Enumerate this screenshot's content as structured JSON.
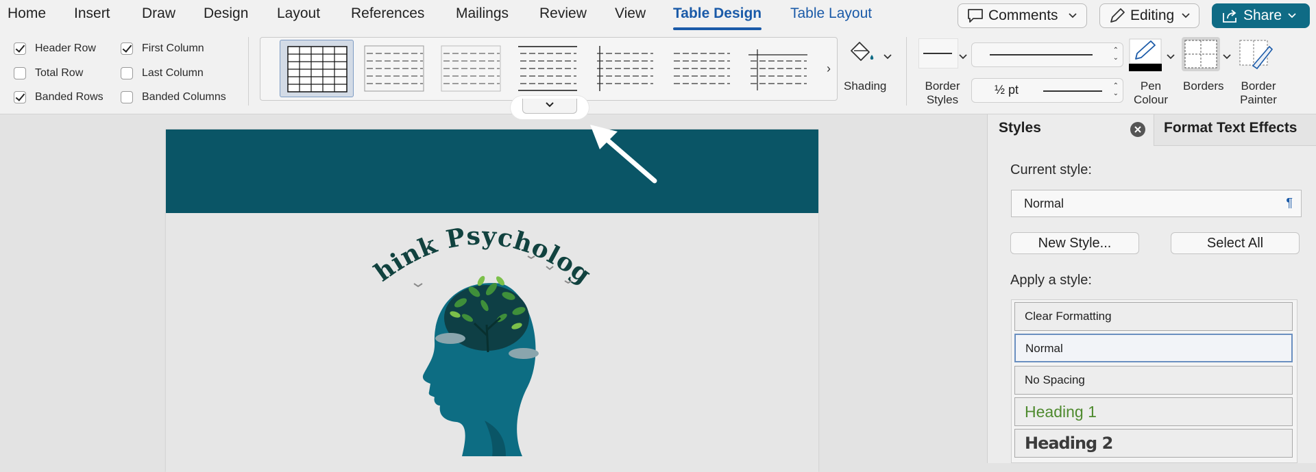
{
  "menu": {
    "tabs": [
      {
        "label": "Home"
      },
      {
        "label": "Insert"
      },
      {
        "label": "Draw"
      },
      {
        "label": "Design"
      },
      {
        "label": "Layout"
      },
      {
        "label": "References"
      },
      {
        "label": "Mailings"
      },
      {
        "label": "Review"
      },
      {
        "label": "View"
      },
      {
        "label": "Table Design",
        "active": true
      },
      {
        "label": "Table Layout"
      }
    ],
    "comments_label": "Comments",
    "editing_label": "Editing",
    "share_label": "Share",
    "share_color": "#0f6b85"
  },
  "ribbon": {
    "options": [
      {
        "label": "Header Row",
        "checked": true
      },
      {
        "label": "Total Row",
        "checked": false
      },
      {
        "label": "Banded Rows",
        "checked": true
      },
      {
        "label": "First Column",
        "checked": true
      },
      {
        "label": "Last Column",
        "checked": false
      },
      {
        "label": "Banded Columns",
        "checked": false
      }
    ],
    "shading_label": "Shading",
    "border_styles_label": "Border Styles",
    "pen_weight": "½ pt",
    "pen_colour_label": "Pen Colour",
    "borders_label": "Borders",
    "border_painter_label": "Border Painter",
    "pen_color": "#000000"
  },
  "document": {
    "band_color": "#0a5566",
    "logo_text": "Think Psychology"
  },
  "styles_pane": {
    "title": "Styles",
    "other_tab": "Format Text Effects",
    "current_style_label": "Current style:",
    "current_style": "Normal",
    "new_style_button": "New Style...",
    "select_all_button": "Select All",
    "apply_label": "Apply a style:",
    "styles": [
      {
        "label": "Clear Formatting"
      },
      {
        "label": "Normal",
        "selected": true
      },
      {
        "label": "No Spacing"
      },
      {
        "label": "Heading 1"
      },
      {
        "label": "Heading 2"
      }
    ]
  }
}
